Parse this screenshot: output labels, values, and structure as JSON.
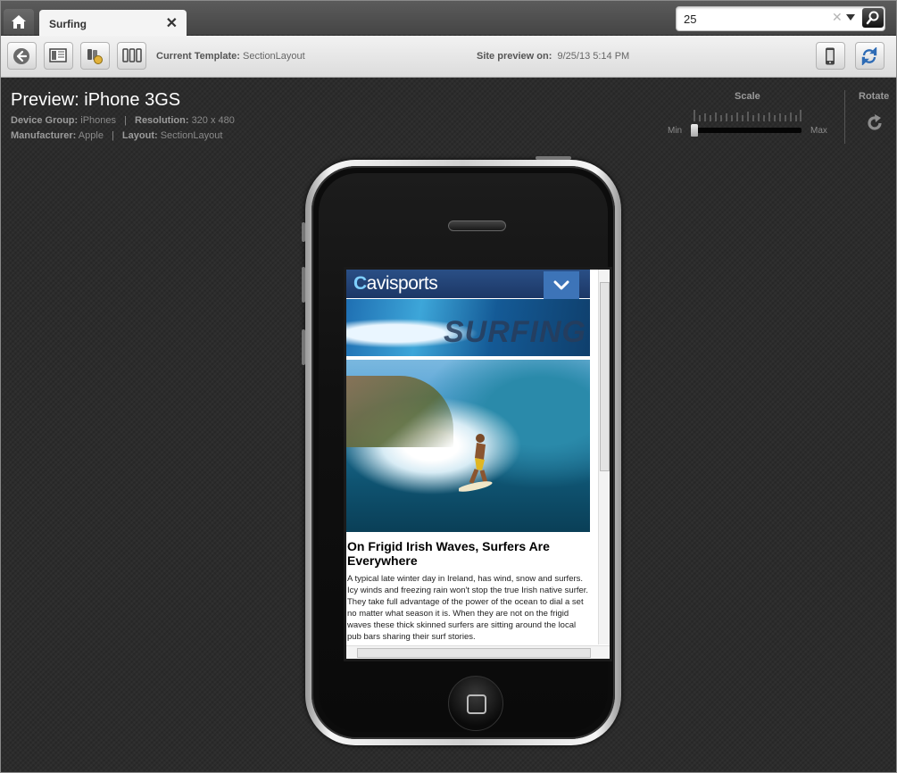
{
  "tabbar": {
    "tab_label": "Surfing",
    "search_value": "25"
  },
  "toolbar": {
    "template_label": "Current Template:",
    "template_value": "SectionLayout",
    "preview_label": "Site preview on:",
    "preview_value": "9/25/13 5:14 PM"
  },
  "preview": {
    "title": "Preview: iPhone 3GS",
    "device_group_label": "Device Group:",
    "device_group": "iPhones",
    "resolution_label": "Resolution:",
    "resolution": "320 x 480",
    "manufacturer_label": "Manufacturer:",
    "manufacturer": "Apple",
    "layout_label": "Layout:",
    "layout": "SectionLayout",
    "separator": "|"
  },
  "scale": {
    "label": "Scale",
    "min": "Min",
    "max": "Max",
    "value": 0
  },
  "rotate": {
    "label": "Rotate"
  },
  "site": {
    "logo_c": "C",
    "logo_text": "avisports",
    "banner_text": "SURFING",
    "article_title": "On Frigid Irish Waves, Surfers Are Everywhere",
    "article_body": "A typical late winter day in Ireland, has wind, snow and surfers. Icy winds and freezing rain won't stop the true Irish native surfer. They take full advantage of the power of the ocean to dial a set no matter what season it is. When they are not on the frigid waves these thick skinned surfers are sitting around the local pub bars sharing their surf stories."
  },
  "icons": {
    "home": "home-icon",
    "close": "close-icon",
    "search": "search-icon",
    "back": "back-arrow-icon",
    "layout": "layout-icon",
    "devices": "device-group-icon",
    "multi": "multi-device-icon",
    "phone": "phone-icon",
    "refresh": "refresh-icon",
    "rotate": "rotate-icon"
  }
}
